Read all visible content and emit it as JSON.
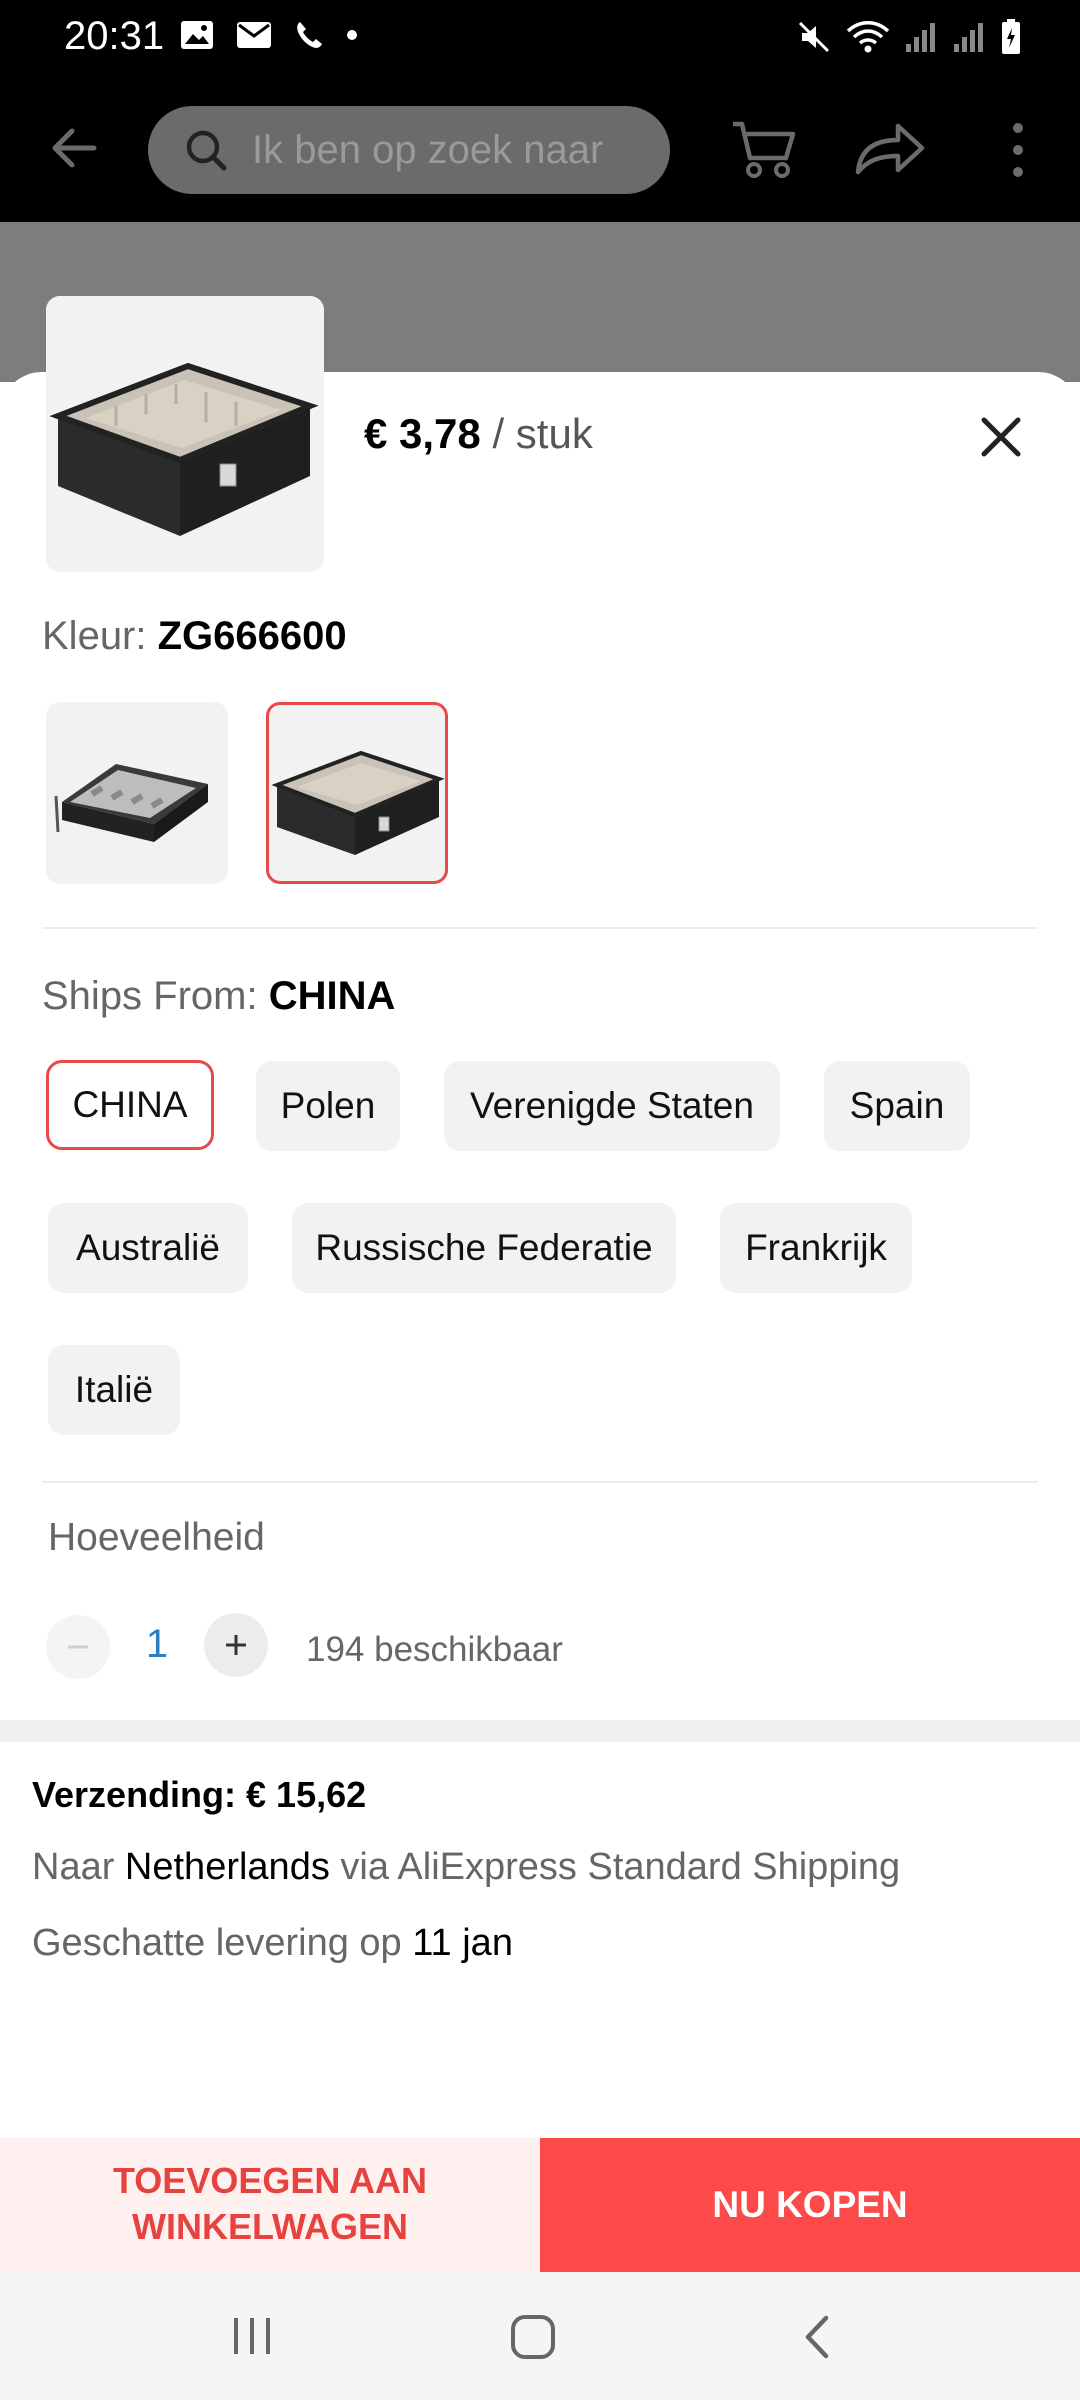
{
  "status_bar": {
    "time": "20:31",
    "left_icons": [
      "image-icon",
      "mail-icon",
      "phone-icon",
      "dot-icon"
    ],
    "right_icons": [
      "mute-icon",
      "wifi-icon",
      "signal-icon",
      "signal-icon",
      "battery-icon"
    ]
  },
  "app_bar": {
    "search_placeholder": "Ik ben op zoek naar",
    "icons": [
      "back-arrow-icon",
      "search-icon",
      "cart-icon",
      "share-icon",
      "more-vertical-icon"
    ]
  },
  "sku_sheet": {
    "price": {
      "amount": "€ 3,78",
      "unit": " / stuk"
    },
    "color": {
      "label": "Kleur: ",
      "value": "ZG666600",
      "variants": [
        {
          "name": "zip-case",
          "selected": false
        },
        {
          "name": "box-case",
          "selected": true
        }
      ]
    },
    "ships_from": {
      "label": "Ships From: ",
      "value": "CHINA",
      "options": [
        {
          "label": "CHINA",
          "selected": true
        },
        {
          "label": "Polen",
          "selected": false
        },
        {
          "label": "Verenigde Staten",
          "selected": false
        },
        {
          "label": "Spain",
          "selected": false
        },
        {
          "label": "Australië",
          "selected": false
        },
        {
          "label": "Russische Federatie",
          "selected": false
        },
        {
          "label": "Frankrijk",
          "selected": false
        },
        {
          "label": "Italië",
          "selected": false
        }
      ]
    },
    "quantity": {
      "label": "Hoeveelheid",
      "value": "1",
      "available": "194 beschikbaar"
    }
  },
  "shipping": {
    "title": "Verzending: € 15,62",
    "line1": {
      "prefix": "Naar ",
      "country": "Netherlands",
      "suffix": " via AliExpress Standard Shipping"
    },
    "line2": {
      "prefix": "Geschatte levering op ",
      "date": "11 jan"
    }
  },
  "actions": {
    "add_to_cart_line1": "TOEVOEGEN AAN",
    "add_to_cart_line2": "WINKELWAGEN",
    "buy_now": "NU KOPEN"
  },
  "nav_bar": {
    "icons": [
      "recent-apps-icon",
      "home-icon",
      "back-icon"
    ]
  },
  "colors": {
    "accent": "#fc4a4b",
    "accent_light": "#fff1f0",
    "selected_border": "#e84a4a",
    "quantity_blue": "#2a7fc4"
  }
}
